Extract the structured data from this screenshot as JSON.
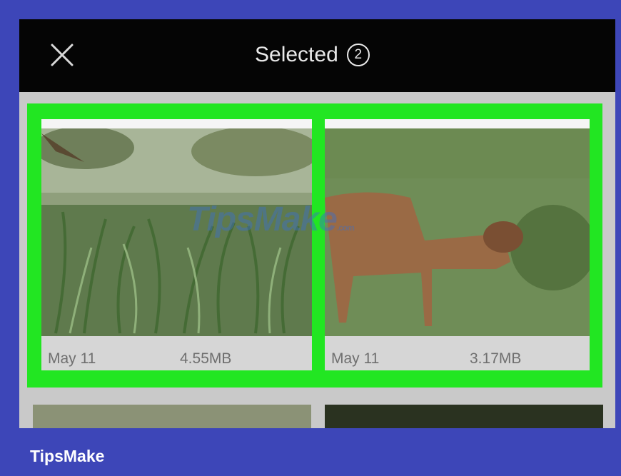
{
  "header": {
    "title": "Selected",
    "selected_count": "2"
  },
  "photos": [
    {
      "date": "May 11",
      "size": "4.55MB"
    },
    {
      "date": "May 11",
      "size": "3.17MB"
    }
  ],
  "watermark": {
    "text": "TipsMake",
    "suffix": ".com"
  },
  "footer": {
    "brand": "TipsMake"
  },
  "colors": {
    "selection_border": "#22e622",
    "frame": "#3d46b8",
    "topbar": "#050505"
  },
  "icons": {
    "close": "close-icon"
  }
}
